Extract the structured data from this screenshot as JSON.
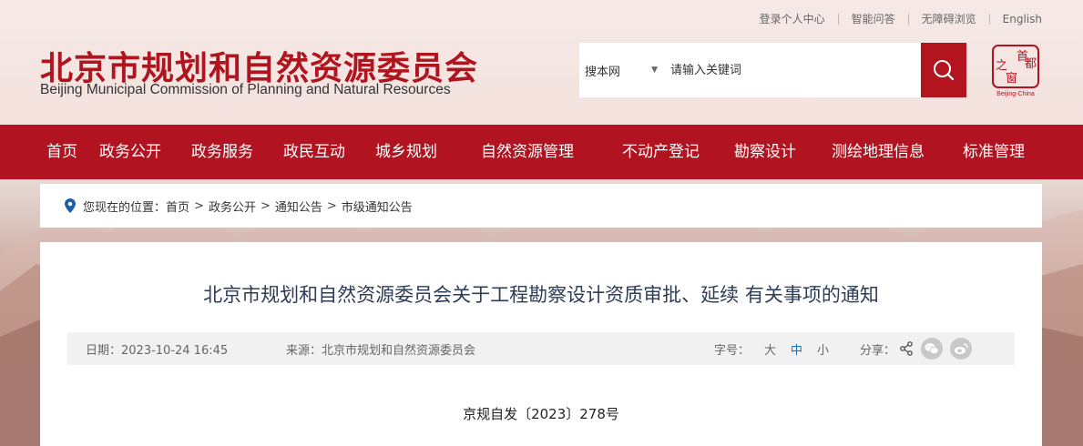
{
  "top_links": [
    "登录个人中心",
    "智能问答",
    "无障碍浏览",
    "English"
  ],
  "logo": {
    "cn": "北京市规划和自然资源委员会",
    "en": "Beijing Municipal Commission of Planning and Natural Resources",
    "seal_chars": [
      "首",
      "都",
      "之",
      "窗"
    ],
    "seal_text": "Beijing-China"
  },
  "search": {
    "scope": "搜本网",
    "placeholder": "请输入关键词"
  },
  "nav": [
    "首页",
    "政务公开",
    "政务服务",
    "政民互动",
    "城乡规划",
    "自然资源管理",
    "不动产登记",
    "勘察设计",
    "测绘地理信息",
    "标准管理"
  ],
  "breadcrumb": {
    "prefix": "您现在的位置：",
    "items": [
      "首页",
      "政务公开",
      "通知公告",
      "市级通知公告"
    ]
  },
  "article": {
    "title": "北京市规划和自然资源委员会关于工程勘察设计资质审批、延续 有关事项的通知",
    "date_label": "日期：2023-10-24 16:45",
    "source_label": "来源：北京市规划和自然资源委员会",
    "font_size_label": "字号：",
    "font_sizes": [
      "大",
      "中",
      "小"
    ],
    "share_label": "分享：",
    "doc_number": "京规自发〔2023〕278号"
  },
  "colors": {
    "brand_red": "#b11320",
    "active_font": "#1b6fb3"
  }
}
